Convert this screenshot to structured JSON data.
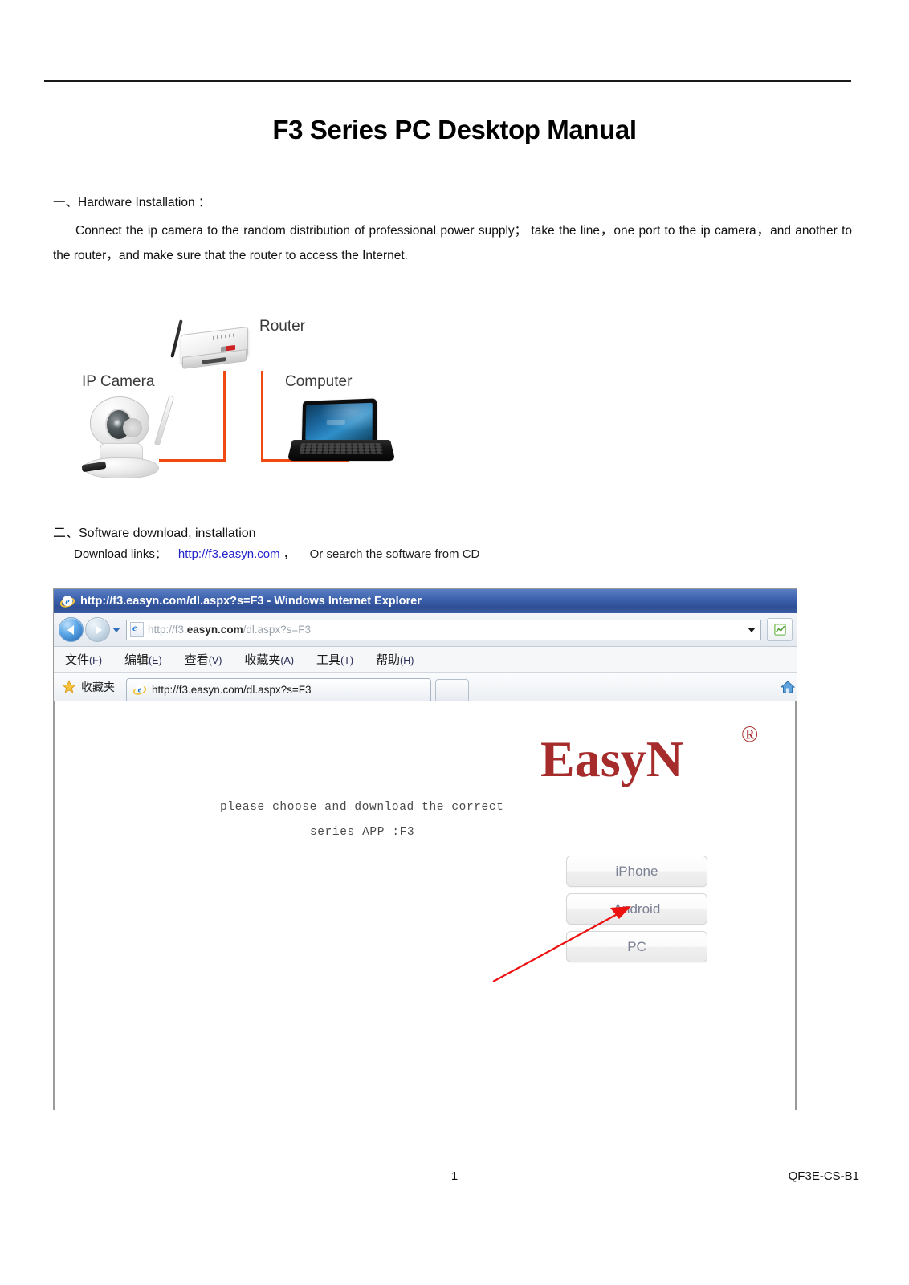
{
  "document": {
    "title": "F3 Series PC Desktop Manual",
    "footer_page_number": "1",
    "footer_code": "QF3E-CS-B1"
  },
  "section1": {
    "heading": "一、Hardware  Installation  ：",
    "paragraph_line1": "Connect the ip camera    to the random distribution of professional power supply；    take the line，one port to the ip",
    "paragraph_line2": "camera，and another to the router，and make sure that the router to access the Internet."
  },
  "diagram": {
    "router_label": "Router",
    "camera_label": "IP Camera",
    "computer_label": "Computer",
    "cable_color": "#f04a12"
  },
  "section2": {
    "heading": "二、Software download, installation",
    "download_label": "Download links：",
    "download_link": "http://f3.easyn.com",
    "download_comma": "，",
    "download_tail": "Or search the software from CD",
    "link_color": "#2222cc"
  },
  "browser": {
    "window_title": "http://f3.easyn.com/dl.aspx?s=F3 - Windows Internet Explorer",
    "address_prefix": "http://f3.",
    "address_domain": "easyn.com",
    "address_suffix": "/dl.aspx?s=F3",
    "menu": [
      {
        "label": "文件",
        "mnemonic": "(F)"
      },
      {
        "label": "编辑",
        "mnemonic": "(E)"
      },
      {
        "label": "查看",
        "mnemonic": "(V)"
      },
      {
        "label": "收藏夹",
        "mnemonic": "(A)"
      },
      {
        "label": "工具",
        "mnemonic": "(T)"
      },
      {
        "label": "帮助",
        "mnemonic": "(H)"
      }
    ],
    "favorites_label": "收藏夹",
    "tab_title": "http://f3.easyn.com/dl.aspx?s=F3",
    "page": {
      "logo_text": "EasyN",
      "logo_registered": "®",
      "logo_color": "#a62c2c",
      "instruction_line1": "please choose and download the correct",
      "instruction_line2": "series APP :F3",
      "buttons": [
        {
          "label": "iPhone"
        },
        {
          "label": "Android"
        },
        {
          "label": "PC"
        }
      ],
      "annotation_arrow_color": "#ee1111",
      "annotation_target": "PC"
    }
  }
}
